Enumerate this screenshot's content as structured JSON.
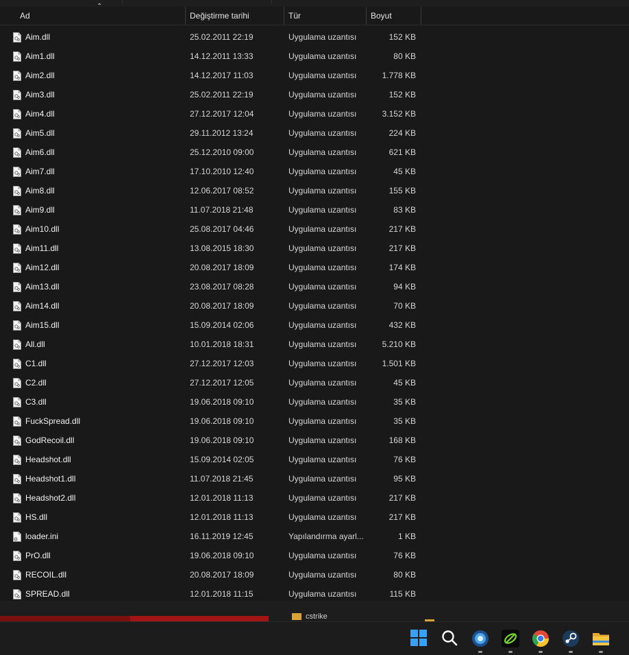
{
  "columns": {
    "name": "Ad",
    "date": "Değiştirme tarihi",
    "type": "Tür",
    "size": "Boyut"
  },
  "files": [
    {
      "name": "Aim.dll",
      "date": "25.02.2011 22:19",
      "type": "Uygulama uzantısı",
      "size": "152 KB",
      "icon": "dll-icon"
    },
    {
      "name": "Aim1.dll",
      "date": "14.12.2011 13:33",
      "type": "Uygulama uzantısı",
      "size": "80 KB",
      "icon": "dll-icon"
    },
    {
      "name": "Aim2.dll",
      "date": "14.12.2017 11:03",
      "type": "Uygulama uzantısı",
      "size": "1.778 KB",
      "icon": "dll-icon"
    },
    {
      "name": "Aim3.dll",
      "date": "25.02.2011 22:19",
      "type": "Uygulama uzantısı",
      "size": "152 KB",
      "icon": "dll-icon"
    },
    {
      "name": "Aim4.dll",
      "date": "27.12.2017 12:04",
      "type": "Uygulama uzantısı",
      "size": "3.152 KB",
      "icon": "dll-icon"
    },
    {
      "name": "Aim5.dll",
      "date": "29.11.2012 13:24",
      "type": "Uygulama uzantısı",
      "size": "224 KB",
      "icon": "dll-icon"
    },
    {
      "name": "Aim6.dll",
      "date": "25.12.2010 09:00",
      "type": "Uygulama uzantısı",
      "size": "621 KB",
      "icon": "dll-icon"
    },
    {
      "name": "Aim7.dll",
      "date": "17.10.2010 12:40",
      "type": "Uygulama uzantısı",
      "size": "45 KB",
      "icon": "dll-icon"
    },
    {
      "name": "Aim8.dll",
      "date": "12.06.2017 08:52",
      "type": "Uygulama uzantısı",
      "size": "155 KB",
      "icon": "dll-icon"
    },
    {
      "name": "Aim9.dll",
      "date": "11.07.2018 21:48",
      "type": "Uygulama uzantısı",
      "size": "83 KB",
      "icon": "dll-icon"
    },
    {
      "name": "Aim10.dll",
      "date": "25.08.2017 04:46",
      "type": "Uygulama uzantısı",
      "size": "217 KB",
      "icon": "dll-icon"
    },
    {
      "name": "Aim11.dll",
      "date": "13.08.2015 18:30",
      "type": "Uygulama uzantısı",
      "size": "217 KB",
      "icon": "dll-icon"
    },
    {
      "name": "Aim12.dll",
      "date": "20.08.2017 18:09",
      "type": "Uygulama uzantısı",
      "size": "174 KB",
      "icon": "dll-icon"
    },
    {
      "name": "Aim13.dll",
      "date": "23.08.2017 08:28",
      "type": "Uygulama uzantısı",
      "size": "94 KB",
      "icon": "dll-icon"
    },
    {
      "name": "Aim14.dll",
      "date": "20.08.2017 18:09",
      "type": "Uygulama uzantısı",
      "size": "70 KB",
      "icon": "dll-icon"
    },
    {
      "name": "Aim15.dll",
      "date": "15.09.2014 02:06",
      "type": "Uygulama uzantısı",
      "size": "432 KB",
      "icon": "dll-icon"
    },
    {
      "name": "All.dll",
      "date": "10.01.2018 18:31",
      "type": "Uygulama uzantısı",
      "size": "5.210 KB",
      "icon": "dll-icon"
    },
    {
      "name": "C1.dll",
      "date": "27.12.2017 12:03",
      "type": "Uygulama uzantısı",
      "size": "1.501 KB",
      "icon": "dll-icon"
    },
    {
      "name": "C2.dll",
      "date": "27.12.2017 12:05",
      "type": "Uygulama uzantısı",
      "size": "45 KB",
      "icon": "dll-icon"
    },
    {
      "name": "C3.dll",
      "date": "19.06.2018 09:10",
      "type": "Uygulama uzantısı",
      "size": "35 KB",
      "icon": "dll-icon"
    },
    {
      "name": "FuckSpread.dll",
      "date": "19.06.2018 09:10",
      "type": "Uygulama uzantısı",
      "size": "35 KB",
      "icon": "dll-icon"
    },
    {
      "name": "GodRecoil.dll",
      "date": "19.06.2018 09:10",
      "type": "Uygulama uzantısı",
      "size": "168 KB",
      "icon": "dll-icon"
    },
    {
      "name": "Headshot.dll",
      "date": "15.09.2014 02:05",
      "type": "Uygulama uzantısı",
      "size": "76 KB",
      "icon": "dll-icon"
    },
    {
      "name": "Headshot1.dll",
      "date": "11.07.2018 21:45",
      "type": "Uygulama uzantısı",
      "size": "95 KB",
      "icon": "dll-icon"
    },
    {
      "name": "Headshot2.dll",
      "date": "12.01.2018 11:13",
      "type": "Uygulama uzantısı",
      "size": "217 KB",
      "icon": "dll-icon"
    },
    {
      "name": "HS.dll",
      "date": "12.01.2018 11:13",
      "type": "Uygulama uzantısı",
      "size": "217 KB",
      "icon": "dll-icon"
    },
    {
      "name": "loader.ini",
      "date": "16.11.2019 12:45",
      "type": "Yapılandırma ayarl...",
      "size": "1 KB",
      "icon": "settings-file-icon"
    },
    {
      "name": "PrO.dll",
      "date": "19.06.2018 09:10",
      "type": "Uygulama uzantısı",
      "size": "76 KB",
      "icon": "dll-icon"
    },
    {
      "name": "RECOIL.dll",
      "date": "20.08.2017 18:09",
      "type": "Uygulama uzantısı",
      "size": "80 KB",
      "icon": "dll-icon"
    },
    {
      "name": "SPREAD.dll",
      "date": "12.01.2018 11:15",
      "type": "Uygulama uzantısı",
      "size": "115 KB",
      "icon": "dll-icon"
    }
  ],
  "background_window": {
    "folder_label": "cstrike"
  },
  "taskbar": {
    "icons": [
      "windows-start-icon",
      "search-icon",
      "app-blue-icon",
      "app-green-icon",
      "chrome-icon",
      "steam-icon",
      "file-explorer-icon"
    ]
  },
  "colors": {
    "background": "#191919",
    "text": "#f2f2f2",
    "folder": "#d9a33a",
    "windows_blue": "#3aa0f3"
  }
}
